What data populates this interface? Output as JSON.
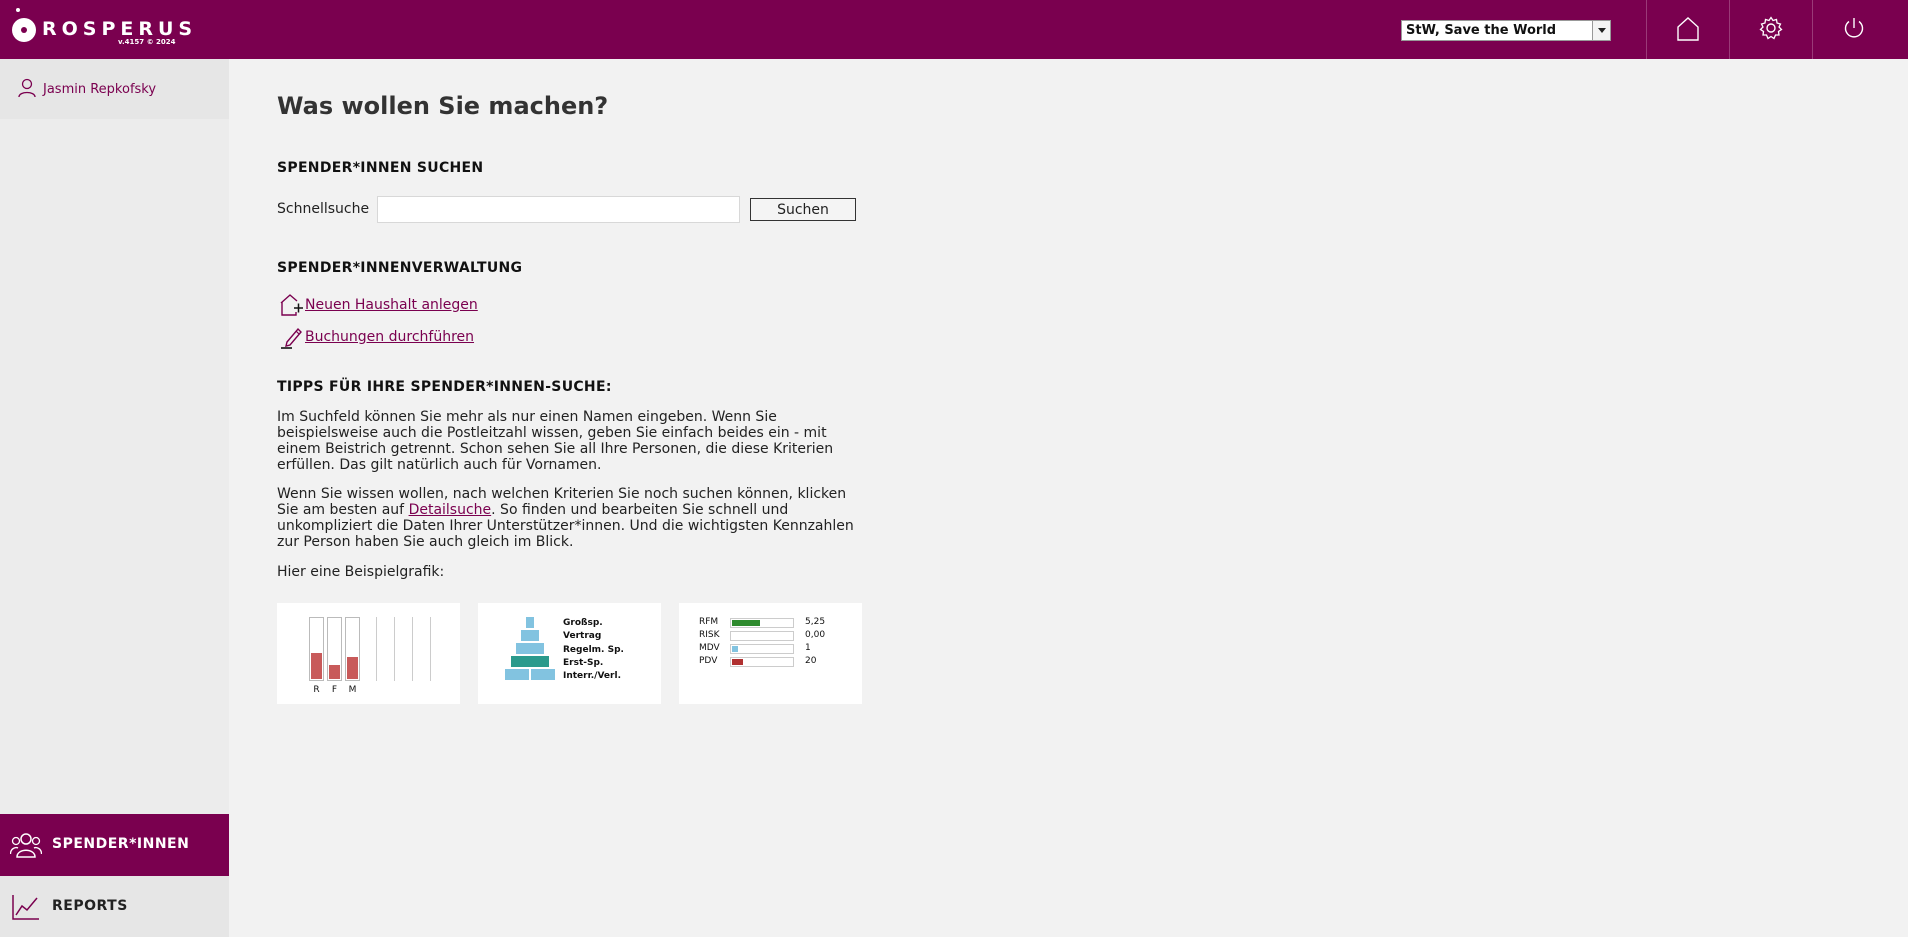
{
  "header": {
    "logo_text": "ROSPERUS",
    "version": "v.4157 © 2024",
    "org_select_value": "StW, Save the World",
    "colors": {
      "brand": "#7a004f"
    }
  },
  "sidebar": {
    "user_name": "Jasmin Repkofsky",
    "nav": [
      {
        "label": "SPENDER*INNEN",
        "icon": "donors-icon",
        "active": true
      },
      {
        "label": "REPORTS",
        "icon": "chart-icon",
        "active": false
      }
    ]
  },
  "main": {
    "title": "Was wollen Sie machen?",
    "search_section": {
      "title": "SPENDER*INNEN SUCHEN",
      "label": "Schnellsuche",
      "input_value": "",
      "button": "Suchen"
    },
    "admin_section": {
      "title": "SPENDER*INNENVERWALTUNG",
      "links": [
        {
          "label": "Neuen Haushalt anlegen",
          "icon": "add-household-icon"
        },
        {
          "label": "Buchungen durchführen",
          "icon": "pen-icon"
        }
      ]
    },
    "tips_section": {
      "title": "TIPPS FÜR IHRE SPENDER*INNEN-SUCHE:",
      "para1": "Im Suchfeld können Sie mehr als nur einen Namen eingeben. Wenn Sie beispielsweise auch die Postleitzahl wissen, geben Sie einfach beides ein - mit einem Beistrich getrennt. Schon sehen Sie all Ihre Personen, die diese Kriterien erfüllen. Das gilt natürlich auch für Vornamen.",
      "para2_before": "Wenn Sie wissen wollen, nach welchen Kriterien Sie noch suchen können, klicken Sie am besten auf ",
      "para2_link": "Detailsuche",
      "para2_after": ". So finden und bearbeiten Sie schnell und unkompliziert die Daten Ihrer Unterstützer*innen. Und die wichtigsten Kennzahlen zur Person haben Sie auch gleich im Blick.",
      "para3": "Hier eine Beispielgrafik:"
    },
    "examples": {
      "rfm_bars": {
        "labels": [
          "R",
          "F",
          "M"
        ],
        "fill_fractions": [
          0.42,
          0.22,
          0.36
        ],
        "bar_color": "#c85a5a"
      },
      "pyramid": {
        "labels": [
          "Großsp.",
          "Vertrag",
          "Regelm. Sp.",
          "Erst-Sp.",
          "Interr./Verl."
        ]
      },
      "kpis": [
        {
          "label": "RFM",
          "value": "5,25",
          "fraction": 0.45,
          "color": "#2e8b2e"
        },
        {
          "label": "RISK",
          "value": "0,00",
          "fraction": 0.0,
          "color": "#2e8b2e"
        },
        {
          "label": "MDV",
          "value": "1",
          "fraction": 0.1,
          "color": "#82c3e0"
        },
        {
          "label": "PDV",
          "value": "20",
          "fraction": 0.18,
          "color": "#b03030"
        }
      ]
    }
  }
}
